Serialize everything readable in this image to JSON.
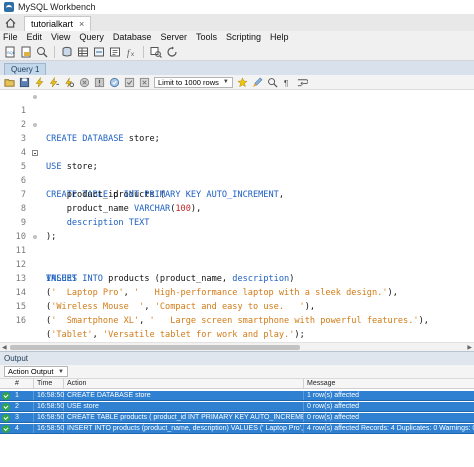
{
  "window": {
    "title": "MySQL Workbench"
  },
  "connection_tab": {
    "label": "tutorialkart",
    "close": "×"
  },
  "menu": [
    "File",
    "Edit",
    "View",
    "Query",
    "Database",
    "Server",
    "Tools",
    "Scripting",
    "Help"
  ],
  "query_tab": {
    "label": "Query 1"
  },
  "editor_toolbar": {
    "limit_label": "Limit to 1000 rows"
  },
  "editor": {
    "lines": [
      {
        "n": "1",
        "marker": "dot"
      },
      {
        "n": "2",
        "marker": ""
      },
      {
        "n": "3",
        "marker": "dot"
      },
      {
        "n": "4",
        "marker": ""
      },
      {
        "n": "5",
        "marker": "fold"
      },
      {
        "n": "6",
        "marker": ""
      },
      {
        "n": "7",
        "marker": ""
      },
      {
        "n": "8",
        "marker": ""
      },
      {
        "n": "9",
        "marker": ""
      },
      {
        "n": "10",
        "marker": ""
      },
      {
        "n": "11",
        "marker": "dot"
      },
      {
        "n": "12",
        "marker": ""
      },
      {
        "n": "13",
        "marker": ""
      },
      {
        "n": "14",
        "marker": ""
      },
      {
        "n": "15",
        "marker": ""
      },
      {
        "n": "16",
        "marker": ""
      }
    ],
    "code": {
      "l1_kw": "CREATE DATABASE",
      "l1_rest": " store;",
      "l3_kw": "USE",
      "l3_rest": " store;",
      "l5_kw": "CREATE TABLE",
      "l5_rest": " products (",
      "l6_name": "    product_id ",
      "l6_kw": "INT PRIMARY KEY AUTO_INCREMENT",
      "l6_end": ",",
      "l7_name": "    product_name ",
      "l7_kw": "VARCHAR",
      "l7_open": "(",
      "l7_num": "100",
      "l7_end": "),",
      "l8_kw": "    description TEXT",
      "l9": ");",
      "l11_kw": "INSERT INTO",
      "l11_mid": " products (product_name, ",
      "l11_kw2": "description",
      "l11_end": ")",
      "l12_kw": "VALUES",
      "l13_open": "(",
      "l13_s1": "'  Laptop Pro'",
      "l13_comma": ", ",
      "l13_s2": "'   High-performance laptop with a sleek design.'",
      "l13_end": "),",
      "l14_open": "(",
      "l14_s1": "'Wireless Mouse  '",
      "l14_comma": ", ",
      "l14_s2": "'Compact and easy to use.   '",
      "l14_end": "),",
      "l15_open": "(",
      "l15_s1": "'  Smartphone XL'",
      "l15_comma": ", ",
      "l15_s2": "'   Large screen smartphone with powerful features.'",
      "l15_end": "),",
      "l16_open": "(",
      "l16_s1": "'Tablet'",
      "l16_comma": ", ",
      "l16_s2": "'Versatile tablet for work and play.'",
      "l16_end": ");"
    }
  },
  "output": {
    "header": "Output",
    "selector": "Action Output",
    "columns": [
      "#",
      "Time",
      "Action",
      "Message"
    ],
    "rows": [
      {
        "num": "1",
        "time": "16:58:50",
        "action": "CREATE DATABASE store",
        "message": "1 row(s) affected"
      },
      {
        "num": "2",
        "time": "16:58:50",
        "action": "USE store",
        "message": "0 row(s) affected"
      },
      {
        "num": "3",
        "time": "16:58:50",
        "action": "CREATE TABLE products (     product_id INT PRIMARY KEY AUTO_INCREMENT,",
        "message": "0 row(s) affected"
      },
      {
        "num": "4",
        "time": "16:58:50",
        "action": "INSERT INTO products (product_name, description) VALUES  ('  Laptop Pro',  '   High-pe",
        "message": "4 row(s) affected Records: 4  Duplicates: 0  Warnings: 0"
      }
    ]
  },
  "colors": {
    "keyword": "#1d5fc1",
    "string": "#d27b17",
    "number": "#c02727",
    "selected_row": "#2f80d1",
    "ok": "#2da44e"
  }
}
